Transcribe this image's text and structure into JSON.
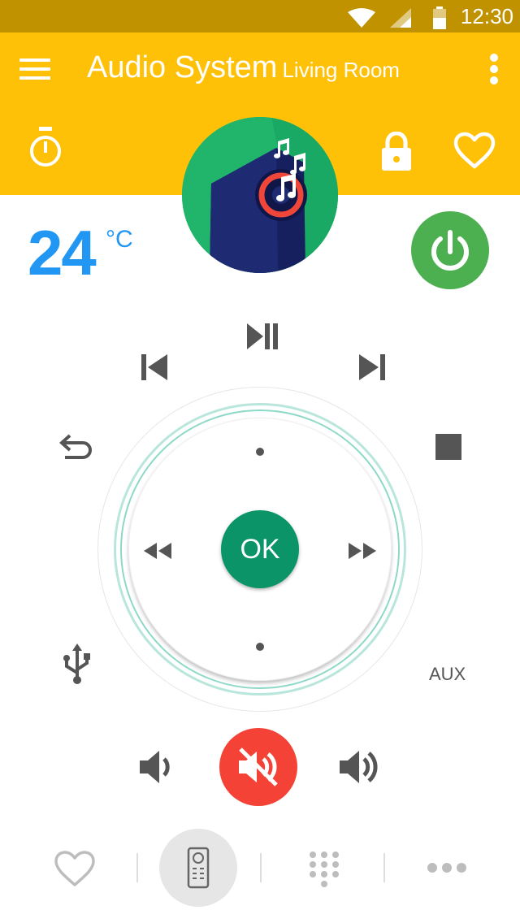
{
  "status_bar": {
    "time": "12:30",
    "icons": [
      "wifi-icon",
      "signal-icon",
      "battery-icon"
    ]
  },
  "app_bar": {
    "title": "Audio System",
    "subtitle": "Living Room",
    "icons": [
      "menu-icon",
      "overflow-menu-icon",
      "timer-icon",
      "lock-icon",
      "heart-icon"
    ]
  },
  "device": {
    "image": "speaker-with-music-notes",
    "temperature": "24",
    "temperature_unit": "°C",
    "power_state": "on"
  },
  "controls": {
    "top": [
      "play-pause-icon",
      "skip-previous-icon",
      "skip-next-icon",
      "back-arrow-icon",
      "stop-icon"
    ],
    "dial": {
      "center_label": "OK",
      "left": "rewind-icon",
      "right": "fast-forward-icon"
    },
    "usb_icon": "usb-icon",
    "aux_label": "AUX",
    "volume": [
      "volume-down-icon",
      "mute-icon",
      "volume-up-icon"
    ]
  },
  "bottom_nav": {
    "items": [
      "favorites-icon",
      "remote-icon",
      "keypad-icon",
      "more-icon"
    ],
    "active": "remote-icon"
  },
  "colors": {
    "status_bar": "#c19200",
    "primary": "#ffc107",
    "temperature": "#2196f3",
    "power": "#4caf50",
    "ok": "#0a9467",
    "mute": "#f44336",
    "icon": "#555555"
  }
}
